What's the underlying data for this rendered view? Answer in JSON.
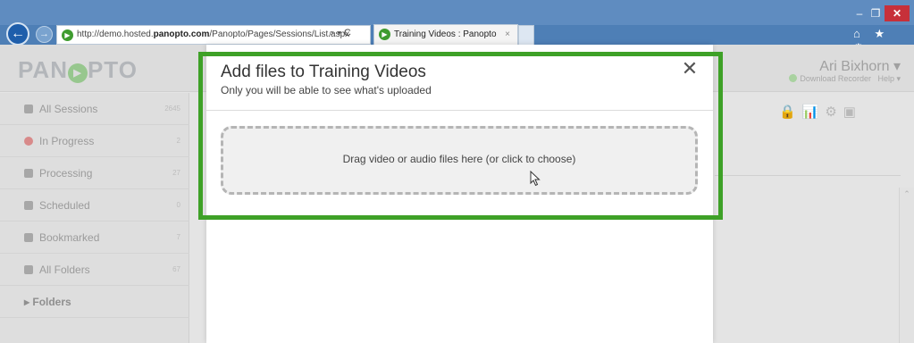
{
  "browser": {
    "back_glyph": "←",
    "forward_glyph": "→",
    "url_prefix": "http://demo.hosted.",
    "url_domain": "panopto.com",
    "url_path": "/Panopto/Pages/Sessions/List.aspx",
    "url_tools": "⌕ ▾ C",
    "tab_title": "Training Videos : Panopto",
    "tab_close": "×",
    "minimize": "–",
    "maximize": "❐",
    "close": "✕",
    "toolbar_icons": "⌂ ★ ⚙"
  },
  "app": {
    "logo_text_1": "PAN",
    "logo_text_2": "PTO",
    "logo_glyph": "▶",
    "user_name": "Ari Bixhorn ▾",
    "download_recorder": "Download Recorder",
    "help": "Help ▾",
    "sidebar": [
      {
        "label": "All Sessions",
        "count": "2645"
      },
      {
        "label": "In Progress",
        "count": "2"
      },
      {
        "label": "Processing",
        "count": "27"
      },
      {
        "label": "Scheduled",
        "count": "0"
      },
      {
        "label": "Bookmarked",
        "count": "7"
      },
      {
        "label": "All Folders",
        "count": "67"
      },
      {
        "label": "▸ Folders",
        "count": ""
      }
    ],
    "content_tools": "🔒📊⚙▣",
    "scroll_up": "⌃"
  },
  "modal": {
    "title": "Add files to Training Videos",
    "subtitle": "Only you will be able to see what's uploaded",
    "close_glyph": "✕",
    "dropzone_text": "Drag video or audio files here (or click to choose)"
  },
  "colors": {
    "highlight": "#3ea127",
    "browser_chrome": "#4e7fb6",
    "window_close": "#c7303a"
  }
}
